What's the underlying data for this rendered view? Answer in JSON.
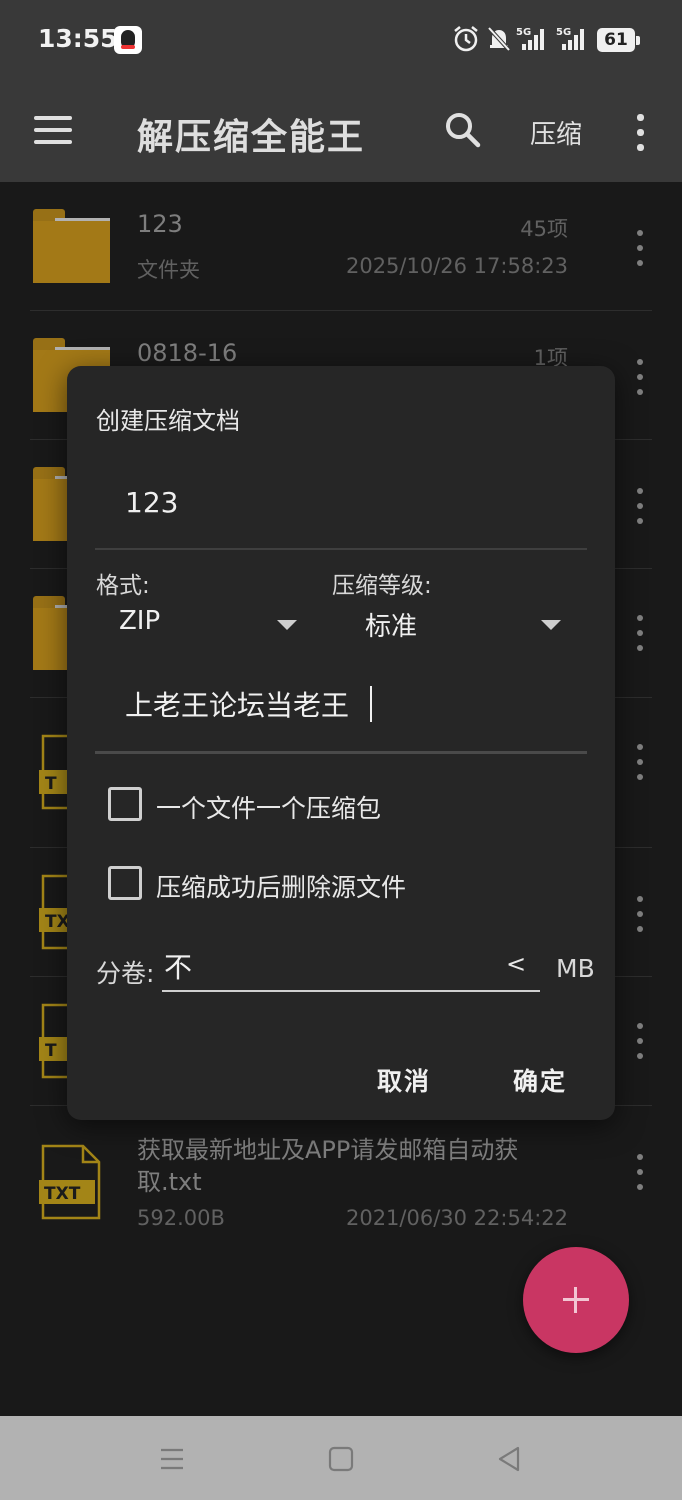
{
  "status_bar": {
    "time": "13:55",
    "signal_1": "5G",
    "signal_2": "5G",
    "battery": "61"
  },
  "app_bar": {
    "title": "解压缩全能王",
    "compress_label": "压缩"
  },
  "files": [
    {
      "name": "123",
      "type_label": "文件夹",
      "count": "45项",
      "date": "2025/10/26 17:58:23",
      "kind": "folder"
    },
    {
      "name": "0818-16",
      "type_label": "",
      "count": "1项",
      "date": "",
      "kind": "folder"
    },
    {
      "name": "",
      "kind": "folder"
    },
    {
      "name": "",
      "kind": "folder"
    },
    {
      "name": "",
      "kind": "txt",
      "icon_text": "T"
    },
    {
      "name": "",
      "kind": "txt",
      "icon_text": "TX"
    },
    {
      "name": "",
      "kind": "txt",
      "icon_text": "T"
    },
    {
      "name_line1": "获取最新地址及APP请发邮箱自动获",
      "name_line2": "取.txt",
      "size": "592.00B",
      "date": "2021/06/30 22:54:22",
      "kind": "txt",
      "icon_text": "TXT"
    }
  ],
  "dialog": {
    "title": "创建压缩文档",
    "archive_name": "123",
    "format_label": "格式:",
    "format_value": "ZIP",
    "level_label": "压缩等级:",
    "level_value": "标准",
    "password_value": "上老王论坛当老王",
    "checkbox_one_per_file": "一个文件一个压缩包",
    "checkbox_delete_source": "压缩成功后删除源文件",
    "split_label": "分卷:",
    "split_value": "不",
    "split_arrow": "<",
    "split_unit": "MB",
    "cancel_label": "取消",
    "ok_label": "确定"
  },
  "colors": {
    "fab": "#c93663",
    "folder": "#c7941d",
    "txt_icon": "#c7a31d",
    "appbar": "#393939"
  }
}
